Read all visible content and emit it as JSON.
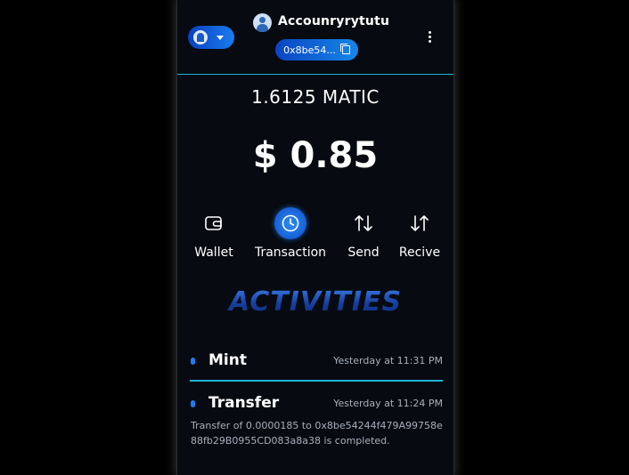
{
  "header": {
    "account_name": "Accounryrytutu",
    "address_short": "0x8be54...",
    "icons": {
      "account_switcher": "avatar-dropdown",
      "avatar": "user-avatar",
      "copy": "copy-icon",
      "menu": "vertical-dots-icon"
    }
  },
  "balance": {
    "token": "1.6125 MATIC",
    "fiat": "$ 0.85"
  },
  "actions": [
    {
      "label": "Wallet",
      "icon": "wallet-icon",
      "active": false
    },
    {
      "label": "Transaction",
      "icon": "clock-icon",
      "active": true
    },
    {
      "label": "Send",
      "icon": "arrows-up-down-icon",
      "active": false
    },
    {
      "label": "Recive",
      "icon": "arrows-down-up-icon",
      "active": false
    }
  ],
  "activities": {
    "title": "ACTIVITIES",
    "items": [
      {
        "name": "Mint",
        "time": "Yesterday at 11:31 PM",
        "description": ""
      },
      {
        "name": "Transfer",
        "time": "Yesterday at 11:24 PM",
        "description": "Transfer of 0.0000185 to 0x8be54244f479A99758e88fb29B0955CD083a8a38 is completed."
      }
    ]
  },
  "colors": {
    "background": "#070a10",
    "accent_blue": "#1a7cf0",
    "divider_cyan": "#1fb4d2",
    "muted_text": "#a8b0bc"
  }
}
